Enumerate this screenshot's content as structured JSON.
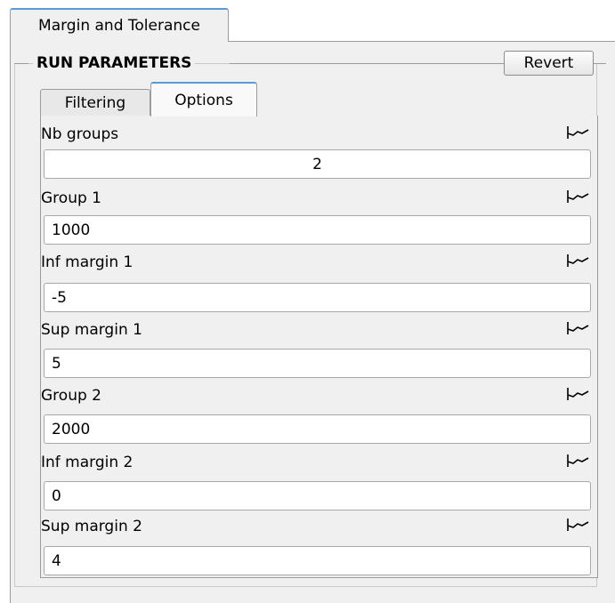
{
  "window": {
    "tab_label": "Margin and Tolerance"
  },
  "group": {
    "title": "RUN PARAMETERS",
    "revert_label": "Revert"
  },
  "inner_tabs": [
    {
      "label": "Filtering",
      "active": false
    },
    {
      "label": "Options",
      "active": true
    }
  ],
  "fields": [
    {
      "label": "Nb groups",
      "value": "2",
      "icon": "curve-icon"
    },
    {
      "label": "Group 1",
      "value": "1000",
      "icon": "curve-icon"
    },
    {
      "label": "Inf margin 1",
      "value": "-5",
      "icon": "curve-icon"
    },
    {
      "label": "Sup margin 1",
      "value": "5",
      "icon": "curve-icon"
    },
    {
      "label": "Group 2",
      "value": "2000",
      "icon": "curve-icon"
    },
    {
      "label": "Inf margin 2",
      "value": "0",
      "icon": "curve-icon"
    },
    {
      "label": "Sup margin 2",
      "value": "4",
      "icon": "curve-icon"
    }
  ],
  "colors": {
    "active_tab_accent": "#5b9bd5",
    "panel_bg": "#f0f0f0"
  }
}
